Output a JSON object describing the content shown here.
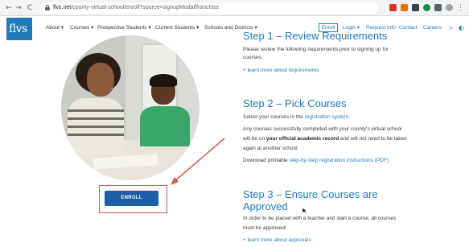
{
  "browser": {
    "url_domain": "flvs.net",
    "url_path": "/county-virtual-school/enroll?source=signupModal/franchise",
    "back_glyph": "←",
    "forward_glyph": "→",
    "reload_glyph": "C"
  },
  "site": {
    "logo_text": "flvs",
    "nav": [
      "About ▾",
      "Courses ▾",
      "Prospective Students ▾",
      "Current Students ▾",
      "Schools and Districts ▾"
    ],
    "enroll_label": "Enroll",
    "login_label": "Login ▾",
    "request_info_label": "Request Info",
    "contact_label": "Contact",
    "careers_label": "Careers"
  },
  "step1": {
    "title": "Step 1 – Review Requirements",
    "line1": "Please review the following requirements prior to signing up for",
    "line2": "courses.",
    "link": "+ learn more about requirements"
  },
  "step2": {
    "title": "Step 2 – Pick Courses",
    "line1_pre": "Select your courses in the ",
    "line1_link": "registration system",
    "line1_post": ".",
    "line2": "Any courses successfully completed with your county's virtual school",
    "line3_pre": "will be on ",
    "line3_bold": "your official academic record",
    "line3_post": " and will not need to be taken",
    "line4": "again at another school.",
    "line5_pre": "Download printable ",
    "line5_link": "step-by-step registration instructions (PDF)",
    "line5_post": "."
  },
  "step3": {
    "title_line1": "Step 3 – Ensure Courses are",
    "title_line2": "Approved",
    "line1": "In order to be placed with a teacher and start a course, all courses",
    "line2": "must be approved!",
    "link": "+ learn more about approvals"
  },
  "hero": {
    "enroll_button": "ENROLL"
  },
  "colors": {
    "brand_blue": "#1f7ab8",
    "button_blue": "#1c5fa8",
    "annotation_red": "#d9534f"
  }
}
